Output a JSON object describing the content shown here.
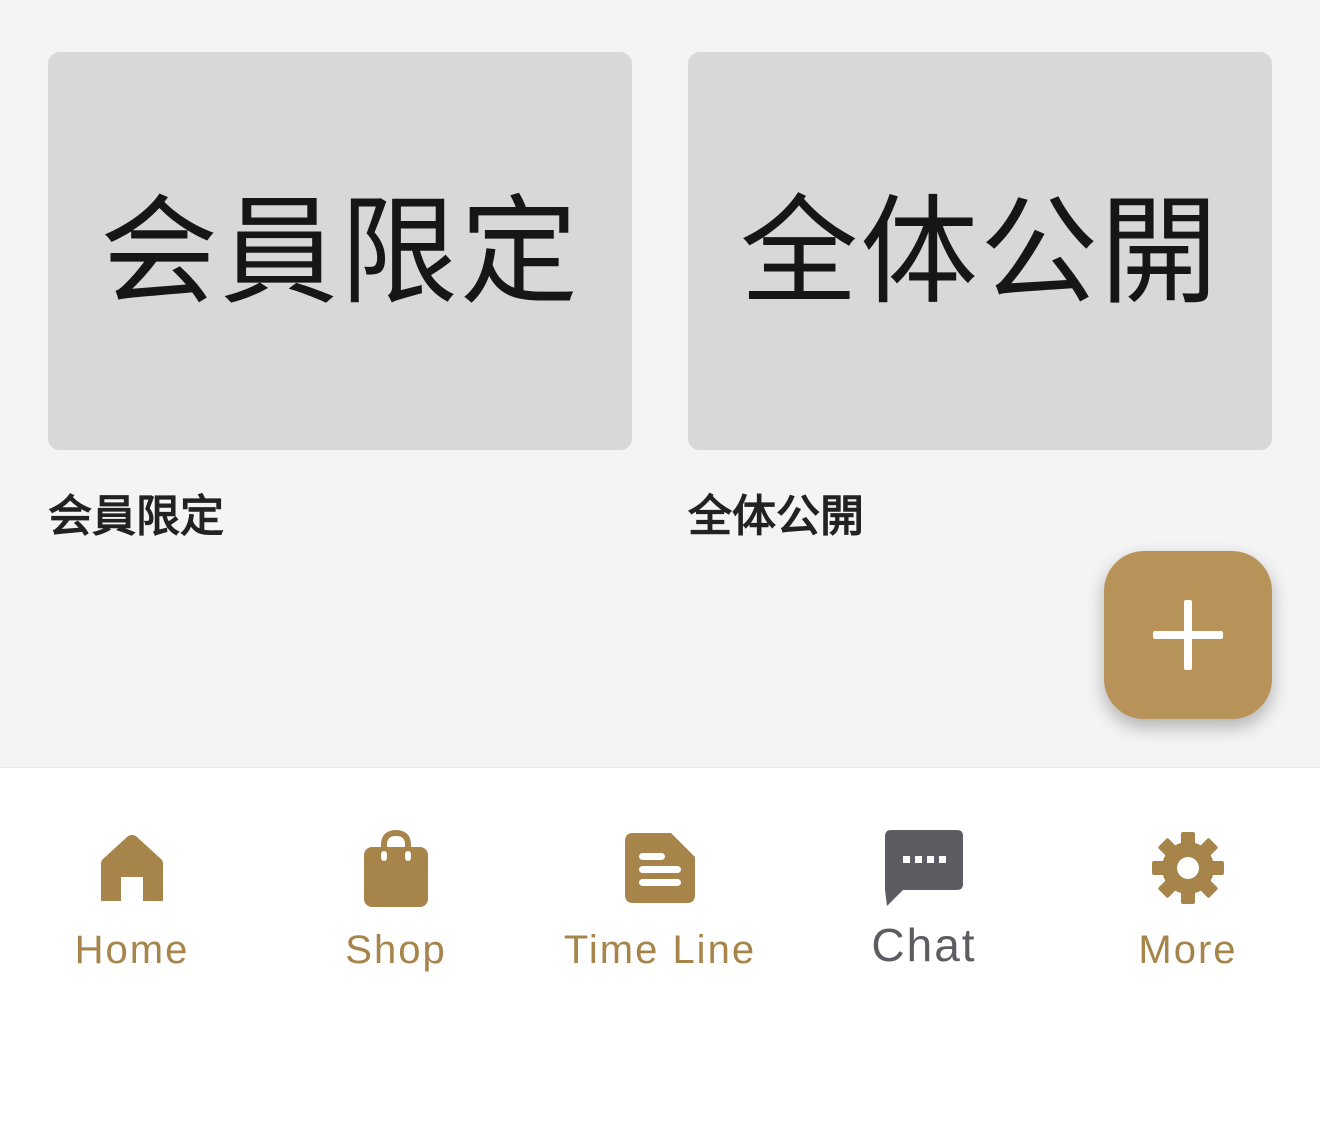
{
  "cards": [
    {
      "thumbnail_text": "会員限定",
      "title": "会員限定"
    },
    {
      "thumbnail_text": "全体公開",
      "title": "全体公開"
    }
  ],
  "fab": {
    "icon": "plus-icon"
  },
  "colors": {
    "accent": "#a78449",
    "fab": "#b89359",
    "active_tab": "#5c5c62",
    "thumb_bg": "#d8d8d8"
  },
  "tabbar": {
    "active": "Chat",
    "tabs": [
      {
        "label": "Home",
        "icon": "home-icon"
      },
      {
        "label": "Shop",
        "icon": "shopping-bag-icon"
      },
      {
        "label": "Time Line",
        "icon": "document-icon"
      },
      {
        "label": "Chat",
        "icon": "chat-bubble-icon"
      },
      {
        "label": "More",
        "icon": "gear-icon"
      }
    ]
  }
}
